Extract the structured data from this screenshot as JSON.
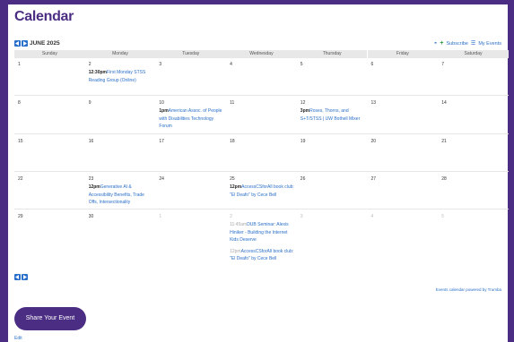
{
  "page_title": "Calendar",
  "month_label": "JUNE 2025",
  "top_links": {
    "subscribe": "Subscribe",
    "my_events": "My Events"
  },
  "weekdays": [
    "Sunday",
    "Monday",
    "Tuesday",
    "Wednesday",
    "Thursday",
    "Friday",
    "Saturday"
  ],
  "weeks": [
    [
      {
        "d": "1"
      },
      {
        "d": "2",
        "events": [
          {
            "time": "12:30pm",
            "title": "First Monday STSS Reading Group (Online)"
          }
        ]
      },
      {
        "d": "3"
      },
      {
        "d": "4"
      },
      {
        "d": "5"
      },
      {
        "d": "6"
      },
      {
        "d": "7"
      }
    ],
    [
      {
        "d": "8"
      },
      {
        "d": "9"
      },
      {
        "d": "10",
        "events": [
          {
            "time": "1pm",
            "title": "American Assoc. of People with Disabilities Technology Forum"
          }
        ]
      },
      {
        "d": "11"
      },
      {
        "d": "12",
        "events": [
          {
            "time": "3pm",
            "title": "Roses, Thorns, and S+T/STSS | UW Bothell Mixer"
          }
        ]
      },
      {
        "d": "13"
      },
      {
        "d": "14"
      }
    ],
    [
      {
        "d": "15"
      },
      {
        "d": "16"
      },
      {
        "d": "17"
      },
      {
        "d": "18"
      },
      {
        "d": "19"
      },
      {
        "d": "20"
      },
      {
        "d": "21"
      }
    ],
    [
      {
        "d": "22"
      },
      {
        "d": "23",
        "events": [
          {
            "time": "12pm",
            "title": "Generative AI & Accessibility Benefits, Trade Offs, Intersectionality"
          }
        ]
      },
      {
        "d": "24"
      },
      {
        "d": "25",
        "events": [
          {
            "time": "12pm",
            "title": "AccessCSforAll book club: \"El Deafo\" by Cece Bell"
          }
        ]
      },
      {
        "d": "26"
      },
      {
        "d": "27"
      },
      {
        "d": "28"
      }
    ],
    [
      {
        "d": "29"
      },
      {
        "d": "30"
      },
      {
        "d": "1",
        "dim": true
      },
      {
        "d": "2",
        "dim": true,
        "events": [
          {
            "time": "11:45am",
            "title": "DUB Seminar: Alexis Hiniker - Building the Internet Kids Deserve",
            "dim": true
          },
          {
            "time": "12pm",
            "title": "AccessCSforAll book club: \"El Deafo\" by Cece Bell",
            "dim": true
          }
        ]
      },
      {
        "d": "3",
        "dim": true
      },
      {
        "d": "4",
        "dim": true
      },
      {
        "d": "5",
        "dim": true
      }
    ]
  ],
  "powered_by": "Events calendar powered by Trumba",
  "share_button": "Share Your Event",
  "edit_link": "Edit",
  "colors": {
    "brand_purple": "#4b2e83",
    "link_blue": "#2a6fc9",
    "green_plus": "#2e9e3a"
  }
}
